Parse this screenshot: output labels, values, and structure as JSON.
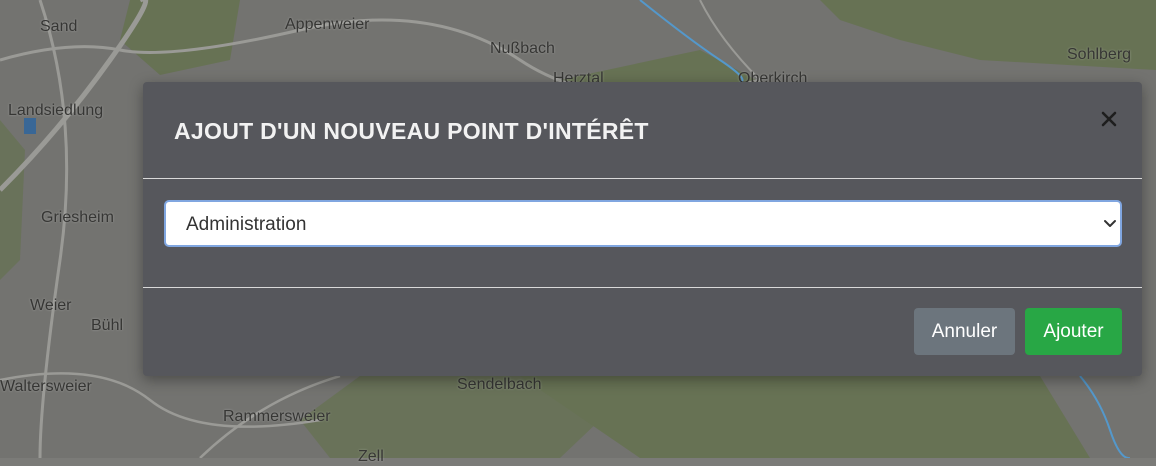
{
  "map": {
    "places": [
      "Sand",
      "Appenweier",
      "Nußbach",
      "Herztal",
      "Oberkirch",
      "Sohlberg",
      "Landsiedlung",
      "Griesheim",
      "Weier",
      "Bühl",
      "Waltersweier",
      "Sendelbach",
      "Rammersweier",
      "Zell"
    ],
    "colors": {
      "land": "#7b7b78",
      "forest": "#6e7a5a",
      "water": "#5aa2d8",
      "road": "#a4a4a0"
    }
  },
  "modal": {
    "title": "AJOUT D'UN NOUVEAU POINT D'INTÉRÊT",
    "close_icon": "close-icon",
    "select": {
      "value": "Administration",
      "chevron_icon": "chevron-down-icon"
    },
    "footer": {
      "cancel_label": "Annuler",
      "add_label": "Ajouter"
    },
    "colors": {
      "modal_bg": "#56575c",
      "cancel": "#6c757d",
      "add": "#28a745",
      "focus": "#80a6e0"
    }
  }
}
